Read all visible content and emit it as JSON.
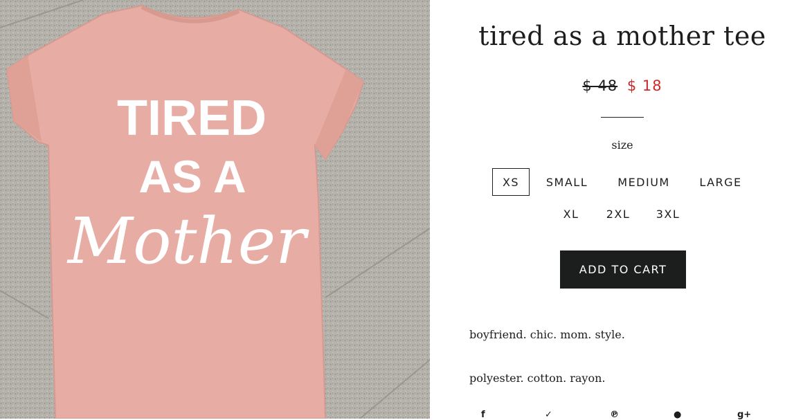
{
  "product": {
    "title": "tired as a mother tee",
    "price_original": "$ 48",
    "price_sale": "$ 18",
    "size_label": "size",
    "sizes": [
      "XS",
      "SMALL",
      "MEDIUM",
      "LARGE",
      "XL",
      "2XL",
      "3XL"
    ],
    "selected_size": "XS",
    "add_to_cart": "ADD TO CART",
    "description_1": "boyfriend. chic. mom. style.",
    "description_2": "polyester. cotton. rayon."
  },
  "image": {
    "shirt_line1": "TIRED",
    "shirt_line2": "AS A",
    "shirt_line3": "Mother",
    "shirt_color": "#e7aca3",
    "background_color": "#b3b0a9"
  },
  "share": {
    "facebook_icon": "facebook-icon",
    "twitter_icon": "twitter-icon",
    "pinterest_icon": "pinterest-icon",
    "fancy_icon": "fancy-icon",
    "googleplus_icon": "google-plus-icon"
  },
  "colors": {
    "sale_red": "#cc2a2a",
    "button_dark": "#1c1d1d"
  }
}
